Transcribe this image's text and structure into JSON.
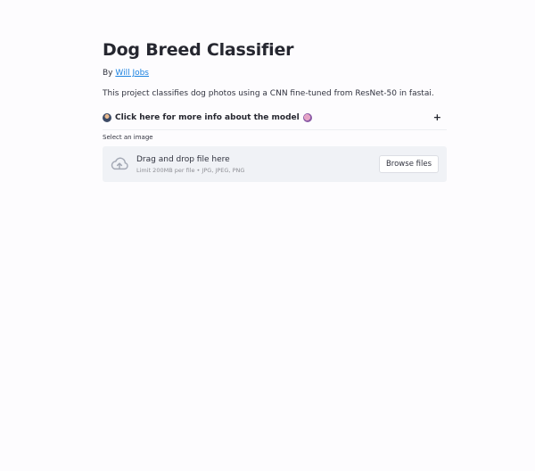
{
  "page": {
    "title": "Dog Breed Classifier",
    "byline_prefix": "By ",
    "author_link": "Will Jobs",
    "description": "This project classifies dog photos using a CNN fine-tuned from ResNet-50 in fastai."
  },
  "expander": {
    "label": "Click here for more info about the model",
    "leading_icon": "person-at-computer-emoji",
    "trailing_icon": "brain-emoji",
    "toggle": "+"
  },
  "uploader": {
    "label": "Select an image",
    "icon": "cloud-upload-icon",
    "drop_text": "Drag and drop file here",
    "limits": "Limit 200MB per file • JPG, JPEG, PNG",
    "browse_label": "Browse files"
  },
  "colors": {
    "background": "#fdfcfe",
    "link": "#1c83e1",
    "dropzone": "#f0f2f6",
    "text": "#31333f"
  }
}
